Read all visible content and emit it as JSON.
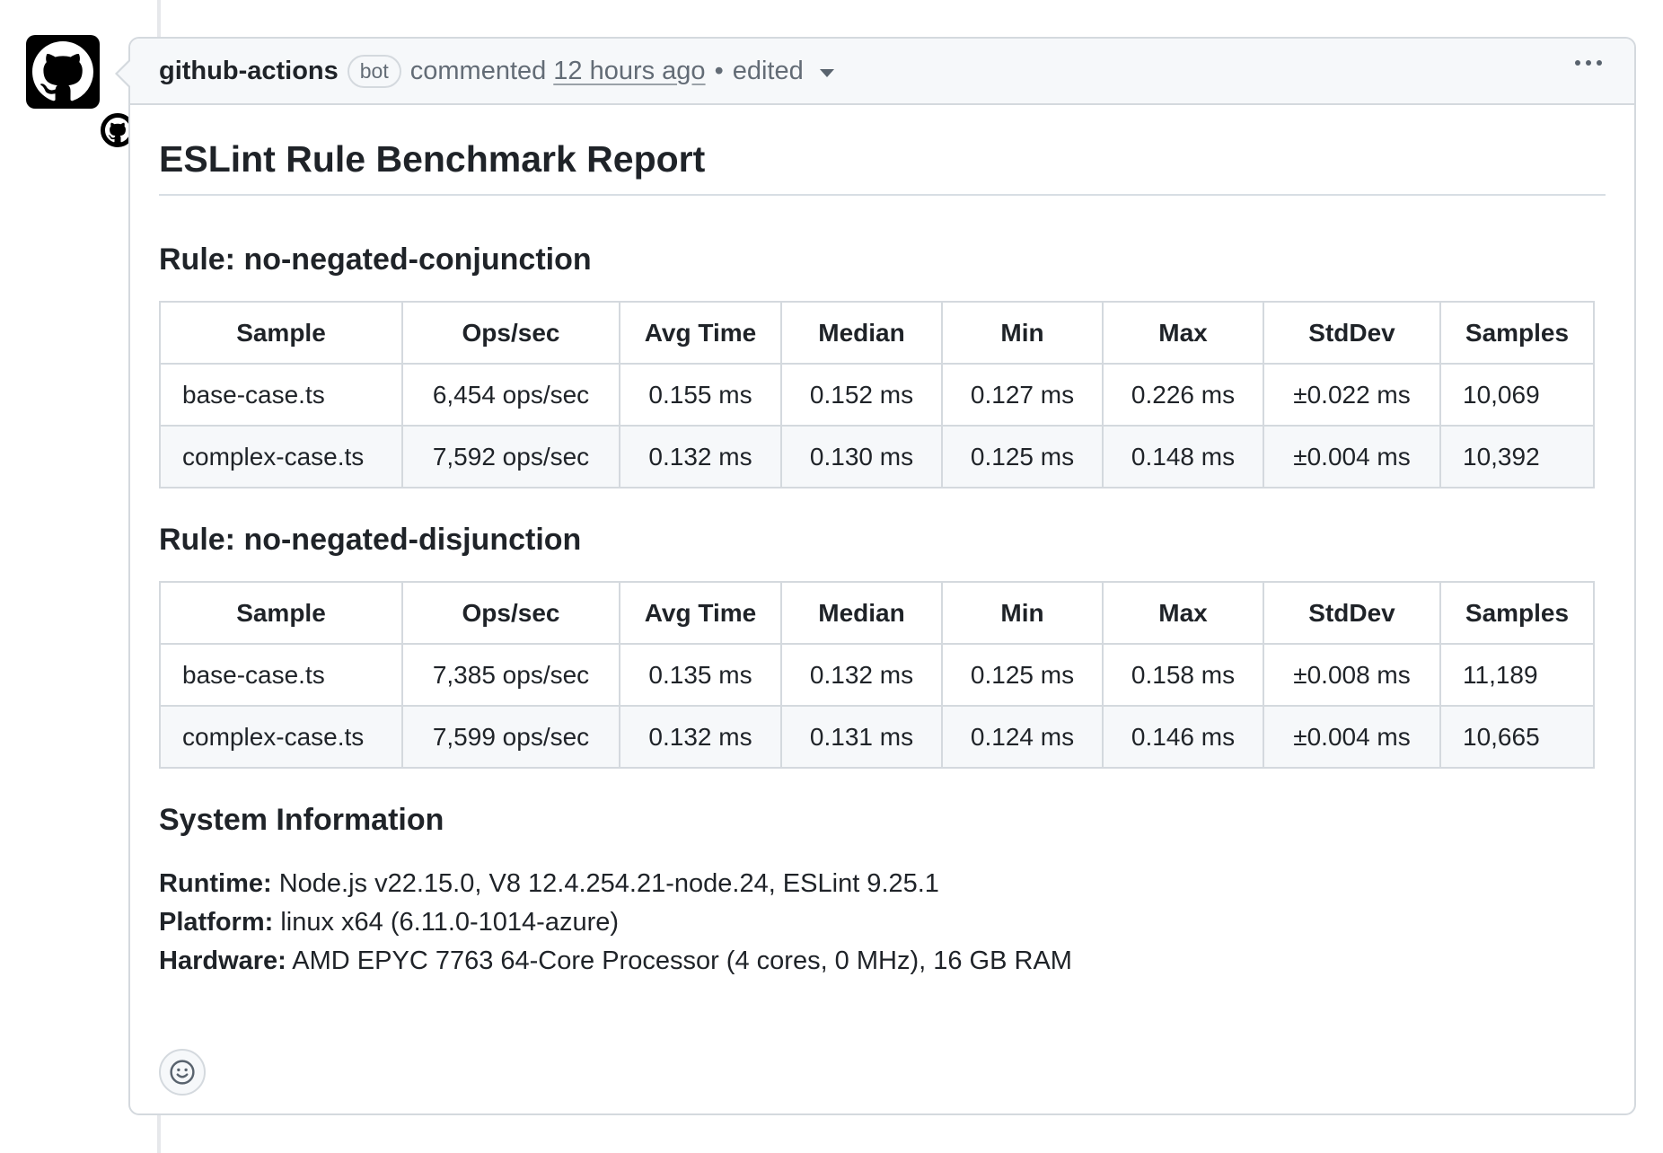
{
  "comment": {
    "author": "github-actions",
    "badge": "bot",
    "action": "commented",
    "timestamp": "12 hours ago",
    "separator": "•",
    "edited": "edited"
  },
  "report": {
    "title": "ESLint Rule Benchmark Report",
    "columns": [
      "Sample",
      "Ops/sec",
      "Avg Time",
      "Median",
      "Min",
      "Max",
      "StdDev",
      "Samples"
    ],
    "rules": [
      {
        "heading": "Rule: no-negated-conjunction",
        "rows": [
          [
            "base-case.ts",
            "6,454 ops/sec",
            "0.155 ms",
            "0.152 ms",
            "0.127 ms",
            "0.226 ms",
            "±0.022 ms",
            "10,069"
          ],
          [
            "complex-case.ts",
            "7,592 ops/sec",
            "0.132 ms",
            "0.130 ms",
            "0.125 ms",
            "0.148 ms",
            "±0.004 ms",
            "10,392"
          ]
        ]
      },
      {
        "heading": "Rule: no-negated-disjunction",
        "rows": [
          [
            "base-case.ts",
            "7,385 ops/sec",
            "0.135 ms",
            "0.132 ms",
            "0.125 ms",
            "0.158 ms",
            "±0.008 ms",
            "11,189"
          ],
          [
            "complex-case.ts",
            "7,599 ops/sec",
            "0.132 ms",
            "0.131 ms",
            "0.124 ms",
            "0.146 ms",
            "±0.004 ms",
            "10,665"
          ]
        ]
      }
    ],
    "system": {
      "heading": "System Information",
      "runtime_label": "Runtime:",
      "runtime_value": " Node.js v22.15.0, V8 12.4.254.21-node.24, ESLint 9.25.1",
      "platform_label": "Platform:",
      "platform_value": " linux x64 (6.11.0-1014-azure)",
      "hardware_label": "Hardware:",
      "hardware_value": " AMD EPYC 7763 64-Core Processor (4 cores, 0 MHz), 16 GB RAM"
    }
  },
  "colors": {
    "border": "#d4d9de",
    "header_bg": "#f6f8fa",
    "text": "#1f2328",
    "muted": "#636c76"
  },
  "icons": {
    "avatar": "github-mark-icon",
    "menu": "kebab-icon",
    "reaction": "smiley-icon"
  }
}
